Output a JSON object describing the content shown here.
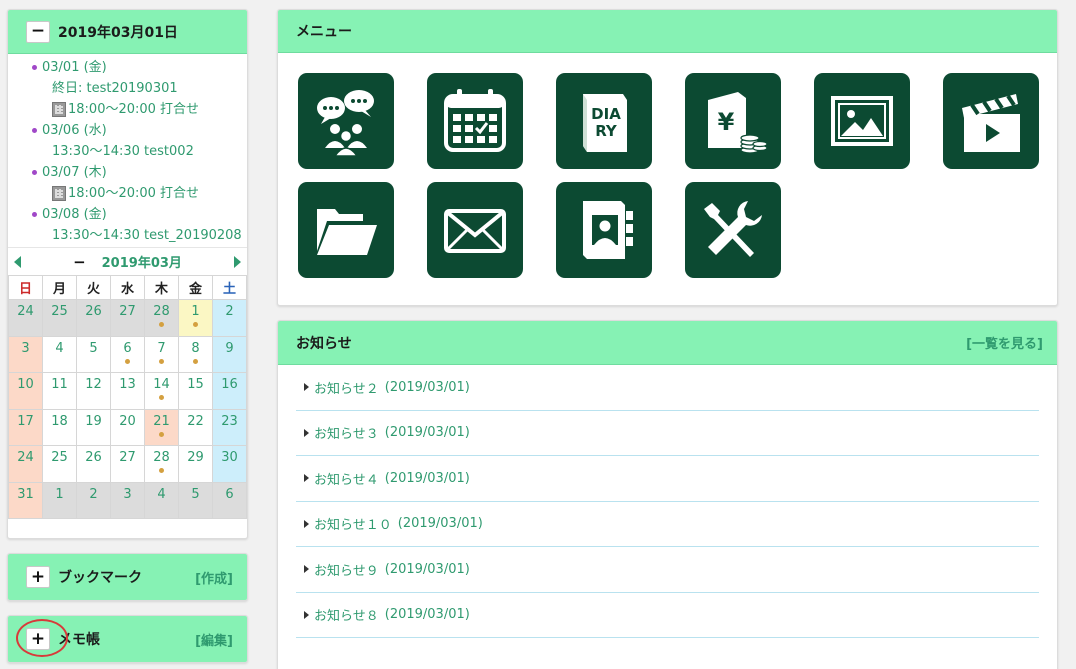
{
  "calendar_panel": {
    "title": "2019年03月01日",
    "toggle": "−",
    "events": [
      {
        "date": "03/01 (金)",
        "details": [
          {
            "text": "終日: test20190301",
            "building": false
          },
          {
            "text": "18:00～20:00 打合せ",
            "building": true
          }
        ]
      },
      {
        "date": "03/06 (水)",
        "details": [
          {
            "text": "13:30～14:30 test002",
            "building": false
          }
        ]
      },
      {
        "date": "03/07 (木)",
        "details": [
          {
            "text": "18:00～20:00 打合せ",
            "building": true
          }
        ]
      },
      {
        "date": "03/08 (金)",
        "details": [
          {
            "text": "13:30～14:30 test_20190208",
            "building": false
          }
        ]
      }
    ],
    "month_label": "2019年03月",
    "month_toggle": "−",
    "weekdays": [
      "日",
      "月",
      "火",
      "水",
      "木",
      "金",
      "土"
    ],
    "weeks": [
      [
        {
          "d": "24",
          "t": "out"
        },
        {
          "d": "25",
          "t": "out"
        },
        {
          "d": "26",
          "t": "out"
        },
        {
          "d": "27",
          "t": "out"
        },
        {
          "d": "28",
          "t": "out",
          "dot": true
        },
        {
          "d": "1",
          "t": "today",
          "dot": true
        },
        {
          "d": "2",
          "t": "sat"
        }
      ],
      [
        {
          "d": "3",
          "t": "sun"
        },
        {
          "d": "4"
        },
        {
          "d": "5"
        },
        {
          "d": "6",
          "dot": true
        },
        {
          "d": "7",
          "dot": true
        },
        {
          "d": "8",
          "dot": true
        },
        {
          "d": "9",
          "t": "sat"
        }
      ],
      [
        {
          "d": "10",
          "t": "sun"
        },
        {
          "d": "11"
        },
        {
          "d": "12"
        },
        {
          "d": "13"
        },
        {
          "d": "14",
          "dot": true
        },
        {
          "d": "15"
        },
        {
          "d": "16",
          "t": "sat"
        }
      ],
      [
        {
          "d": "17",
          "t": "sun"
        },
        {
          "d": "18"
        },
        {
          "d": "19"
        },
        {
          "d": "20"
        },
        {
          "d": "21",
          "t": "holiday",
          "dot": true
        },
        {
          "d": "22"
        },
        {
          "d": "23",
          "t": "sat"
        }
      ],
      [
        {
          "d": "24",
          "t": "sun"
        },
        {
          "d": "25"
        },
        {
          "d": "26"
        },
        {
          "d": "27"
        },
        {
          "d": "28",
          "dot": true
        },
        {
          "d": "29"
        },
        {
          "d": "30",
          "t": "sat"
        }
      ],
      [
        {
          "d": "31",
          "t": "sun"
        },
        {
          "d": "1",
          "t": "out"
        },
        {
          "d": "2",
          "t": "out"
        },
        {
          "d": "3",
          "t": "out"
        },
        {
          "d": "4",
          "t": "out"
        },
        {
          "d": "5",
          "t": "out"
        },
        {
          "d": "6",
          "t": "out"
        }
      ]
    ]
  },
  "bookmark_panel": {
    "title": "ブックマーク",
    "toggle": "+",
    "link": "[作成]"
  },
  "memo_panel": {
    "title": "メモ帳",
    "toggle": "+",
    "link": "[編集]"
  },
  "menu_panel": {
    "title": "メニュー",
    "icons": [
      "chat-group-icon",
      "calendar-icon",
      "diary-icon",
      "expense-yen-icon",
      "image-icon",
      "video-clapper-icon",
      "folder-icon",
      "mail-icon",
      "address-book-icon",
      "tools-icon"
    ],
    "diary_text_1": "DIA",
    "diary_text_2": "RY",
    "yen_symbol": "¥"
  },
  "news_panel": {
    "title": "お知らせ",
    "link": "[一覧を見る]",
    "items": [
      {
        "title": "お知らせ２",
        "date": "(2019/03/01)"
      },
      {
        "title": "お知らせ３",
        "date": "(2019/03/01)"
      },
      {
        "title": "お知らせ４",
        "date": "(2019/03/01)"
      },
      {
        "title": "お知らせ１０",
        "date": "(2019/03/01)"
      },
      {
        "title": "お知らせ９",
        "date": "(2019/03/01)"
      },
      {
        "title": "お知らせ８",
        "date": "(2019/03/01)"
      }
    ]
  },
  "colors": {
    "header_green": "#86f2b4",
    "tile_green": "#0c4a32",
    "link_green": "#2f9a6f",
    "highlight_red": "#d83a3a"
  }
}
